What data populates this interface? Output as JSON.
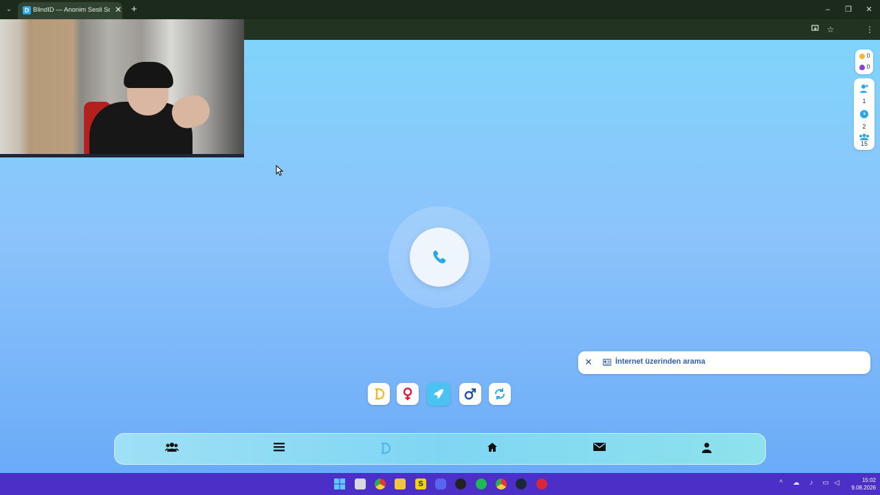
{
  "browser": {
    "tab_title": "BlindID — Anonim Sesli Sohbet",
    "tab_favicon_letter": "D",
    "tab_close": "✕",
    "new_tab": "+",
    "tab_list": "⌄",
    "window_minimize": "–",
    "window_restore": "❐",
    "window_close": "✕"
  },
  "stats": {
    "coins": "0",
    "gems": "0",
    "friends": "1",
    "pending": "2",
    "online": "15"
  },
  "toast": {
    "close": "✕",
    "text": "İnternet üzerinden arama"
  },
  "filters": [
    {
      "name": "blindid-filter",
      "icon": "blindid-logo-icon"
    },
    {
      "name": "female-filter",
      "icon": "female-icon"
    },
    {
      "name": "random-filter",
      "icon": "rocket-icon"
    },
    {
      "name": "male-filter",
      "icon": "male-icon"
    },
    {
      "name": "refresh-filter",
      "icon": "refresh-icon"
    }
  ],
  "colors": {
    "accent": "#4bc3f2",
    "female": "#d81b3a",
    "male": "#1f4fa6",
    "coin": "#f5b82e",
    "gem": "#8a3fd1",
    "taskbar": "#4b2fc6"
  },
  "taskbar": {
    "time": "15:02",
    "date": "9.08.2026"
  }
}
